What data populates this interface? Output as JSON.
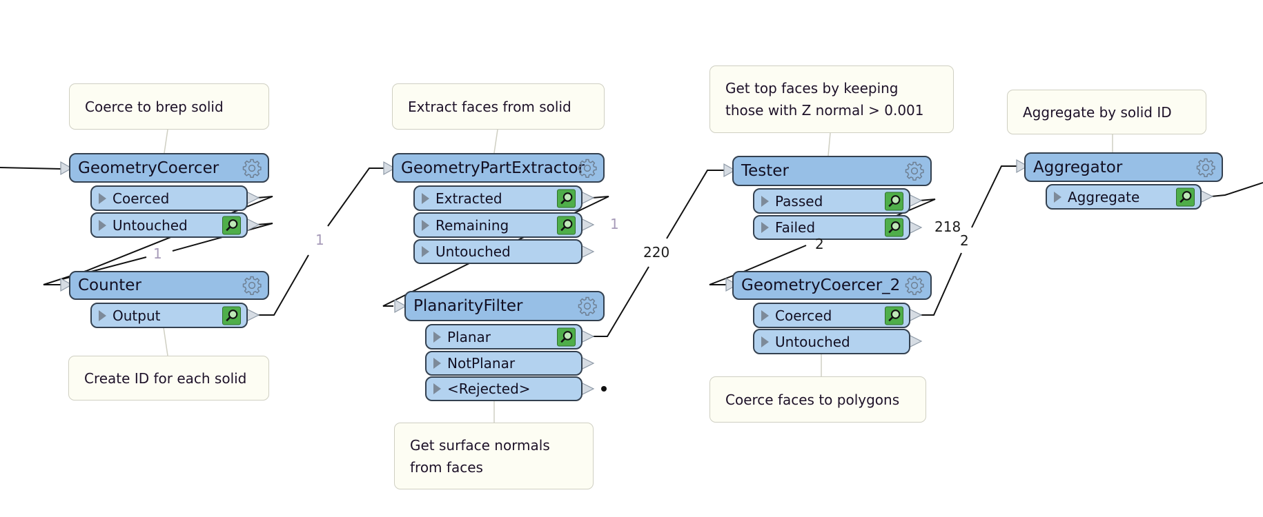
{
  "canvas": {
    "annotations": [
      {
        "id": "a1",
        "text": "Coerce to brep solid"
      },
      {
        "id": "a2",
        "text": "Create ID for each solid"
      },
      {
        "id": "a3",
        "text": "Extract faces from solid"
      },
      {
        "id": "a4",
        "text": "Get surface normals\nfrom faces"
      },
      {
        "id": "a5",
        "text": "Get top faces by keeping\nthose with Z normal > 0.001"
      },
      {
        "id": "a6",
        "text": "Coerce faces to polygons"
      },
      {
        "id": "a7",
        "text": "Aggregate by solid ID"
      }
    ],
    "transformers": [
      {
        "name": "GeometryCoercer",
        "ports": [
          {
            "label": "Coerced",
            "inspect": false
          },
          {
            "label": "Untouched",
            "inspect": true
          }
        ]
      },
      {
        "name": "Counter",
        "ports": [
          {
            "label": "Output",
            "inspect": true
          }
        ]
      },
      {
        "name": "GeometryPartExtractor",
        "ports": [
          {
            "label": "Extracted",
            "inspect": true
          },
          {
            "label": "Remaining",
            "inspect": true
          },
          {
            "label": "Untouched",
            "inspect": false
          }
        ]
      },
      {
        "name": "PlanarityFilter",
        "ports": [
          {
            "label": "Planar",
            "inspect": true
          },
          {
            "label": "NotPlanar",
            "inspect": false
          },
          {
            "label": "<Rejected>",
            "inspect": false
          }
        ]
      },
      {
        "name": "Tester",
        "ports": [
          {
            "label": "Passed",
            "inspect": true
          },
          {
            "label": "Failed",
            "inspect": true
          }
        ]
      },
      {
        "name": "GeometryCoercer_2",
        "ports": [
          {
            "label": "Coerced",
            "inspect": true
          },
          {
            "label": "Untouched",
            "inspect": false
          }
        ]
      },
      {
        "name": "Aggregator",
        "ports": [
          {
            "label": "Aggregate",
            "inspect": true
          }
        ]
      }
    ],
    "link_counts": {
      "coercer_to_counter": "1",
      "counter_to_extractor": "1",
      "remaining": "1",
      "planar_to_tester": "220",
      "failed": "218",
      "passed_to_coercer2": "2",
      "coercer2_to_aggregator": "2"
    },
    "colors": {
      "header_fill": "#97bfe6",
      "port_fill": "#b3d2ef",
      "border": "#33404f",
      "annotation_fill": "#fdfdf3",
      "inspect_green": "#4fae4a"
    }
  }
}
